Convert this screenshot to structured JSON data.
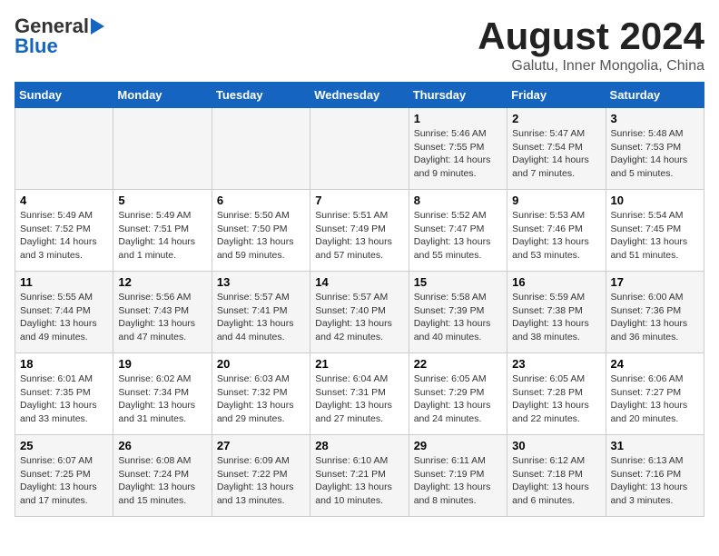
{
  "header": {
    "logo_line1_general": "General",
    "logo_line1_blue": "Blue",
    "logo_line2": "Blue",
    "main_title": "August 2024",
    "subtitle": "Galutu, Inner Mongolia, China"
  },
  "weekdays": [
    "Sunday",
    "Monday",
    "Tuesday",
    "Wednesday",
    "Thursday",
    "Friday",
    "Saturday"
  ],
  "weeks": [
    {
      "days": [
        {
          "num": "",
          "info": ""
        },
        {
          "num": "",
          "info": ""
        },
        {
          "num": "",
          "info": ""
        },
        {
          "num": "",
          "info": ""
        },
        {
          "num": "1",
          "info": "Sunrise: 5:46 AM\nSunset: 7:55 PM\nDaylight: 14 hours\nand 9 minutes."
        },
        {
          "num": "2",
          "info": "Sunrise: 5:47 AM\nSunset: 7:54 PM\nDaylight: 14 hours\nand 7 minutes."
        },
        {
          "num": "3",
          "info": "Sunrise: 5:48 AM\nSunset: 7:53 PM\nDaylight: 14 hours\nand 5 minutes."
        }
      ]
    },
    {
      "days": [
        {
          "num": "4",
          "info": "Sunrise: 5:49 AM\nSunset: 7:52 PM\nDaylight: 14 hours\nand 3 minutes."
        },
        {
          "num": "5",
          "info": "Sunrise: 5:49 AM\nSunset: 7:51 PM\nDaylight: 14 hours\nand 1 minute."
        },
        {
          "num": "6",
          "info": "Sunrise: 5:50 AM\nSunset: 7:50 PM\nDaylight: 13 hours\nand 59 minutes."
        },
        {
          "num": "7",
          "info": "Sunrise: 5:51 AM\nSunset: 7:49 PM\nDaylight: 13 hours\nand 57 minutes."
        },
        {
          "num": "8",
          "info": "Sunrise: 5:52 AM\nSunset: 7:47 PM\nDaylight: 13 hours\nand 55 minutes."
        },
        {
          "num": "9",
          "info": "Sunrise: 5:53 AM\nSunset: 7:46 PM\nDaylight: 13 hours\nand 53 minutes."
        },
        {
          "num": "10",
          "info": "Sunrise: 5:54 AM\nSunset: 7:45 PM\nDaylight: 13 hours\nand 51 minutes."
        }
      ]
    },
    {
      "days": [
        {
          "num": "11",
          "info": "Sunrise: 5:55 AM\nSunset: 7:44 PM\nDaylight: 13 hours\nand 49 minutes."
        },
        {
          "num": "12",
          "info": "Sunrise: 5:56 AM\nSunset: 7:43 PM\nDaylight: 13 hours\nand 47 minutes."
        },
        {
          "num": "13",
          "info": "Sunrise: 5:57 AM\nSunset: 7:41 PM\nDaylight: 13 hours\nand 44 minutes."
        },
        {
          "num": "14",
          "info": "Sunrise: 5:57 AM\nSunset: 7:40 PM\nDaylight: 13 hours\nand 42 minutes."
        },
        {
          "num": "15",
          "info": "Sunrise: 5:58 AM\nSunset: 7:39 PM\nDaylight: 13 hours\nand 40 minutes."
        },
        {
          "num": "16",
          "info": "Sunrise: 5:59 AM\nSunset: 7:38 PM\nDaylight: 13 hours\nand 38 minutes."
        },
        {
          "num": "17",
          "info": "Sunrise: 6:00 AM\nSunset: 7:36 PM\nDaylight: 13 hours\nand 36 minutes."
        }
      ]
    },
    {
      "days": [
        {
          "num": "18",
          "info": "Sunrise: 6:01 AM\nSunset: 7:35 PM\nDaylight: 13 hours\nand 33 minutes."
        },
        {
          "num": "19",
          "info": "Sunrise: 6:02 AM\nSunset: 7:34 PM\nDaylight: 13 hours\nand 31 minutes."
        },
        {
          "num": "20",
          "info": "Sunrise: 6:03 AM\nSunset: 7:32 PM\nDaylight: 13 hours\nand 29 minutes."
        },
        {
          "num": "21",
          "info": "Sunrise: 6:04 AM\nSunset: 7:31 PM\nDaylight: 13 hours\nand 27 minutes."
        },
        {
          "num": "22",
          "info": "Sunrise: 6:05 AM\nSunset: 7:29 PM\nDaylight: 13 hours\nand 24 minutes."
        },
        {
          "num": "23",
          "info": "Sunrise: 6:05 AM\nSunset: 7:28 PM\nDaylight: 13 hours\nand 22 minutes."
        },
        {
          "num": "24",
          "info": "Sunrise: 6:06 AM\nSunset: 7:27 PM\nDaylight: 13 hours\nand 20 minutes."
        }
      ]
    },
    {
      "days": [
        {
          "num": "25",
          "info": "Sunrise: 6:07 AM\nSunset: 7:25 PM\nDaylight: 13 hours\nand 17 minutes."
        },
        {
          "num": "26",
          "info": "Sunrise: 6:08 AM\nSunset: 7:24 PM\nDaylight: 13 hours\nand 15 minutes."
        },
        {
          "num": "27",
          "info": "Sunrise: 6:09 AM\nSunset: 7:22 PM\nDaylight: 13 hours\nand 13 minutes."
        },
        {
          "num": "28",
          "info": "Sunrise: 6:10 AM\nSunset: 7:21 PM\nDaylight: 13 hours\nand 10 minutes."
        },
        {
          "num": "29",
          "info": "Sunrise: 6:11 AM\nSunset: 7:19 PM\nDaylight: 13 hours\nand 8 minutes."
        },
        {
          "num": "30",
          "info": "Sunrise: 6:12 AM\nSunset: 7:18 PM\nDaylight: 13 hours\nand 6 minutes."
        },
        {
          "num": "31",
          "info": "Sunrise: 6:13 AM\nSunset: 7:16 PM\nDaylight: 13 hours\nand 3 minutes."
        }
      ]
    }
  ]
}
